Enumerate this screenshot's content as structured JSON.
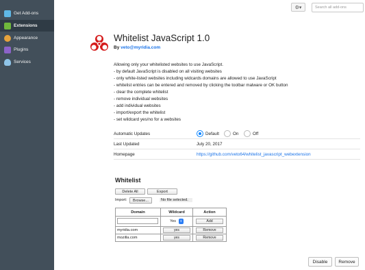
{
  "sidebar": {
    "items": [
      {
        "label": "Get Add-ons",
        "icon": "get-addons-icon",
        "color": "#5fb8e6"
      },
      {
        "label": "Extensions",
        "icon": "puzzle-icon",
        "color": "#6fb83c"
      },
      {
        "label": "Appearance",
        "icon": "palette-icon",
        "color": "#e6a23c"
      },
      {
        "label": "Plugins",
        "icon": "plugin-icon",
        "color": "#8c63c9"
      },
      {
        "label": "Services",
        "icon": "cloud-icon",
        "color": "#8fc4e8"
      }
    ]
  },
  "toolbar": {
    "gear_label": "⚙▾",
    "search_placeholder": "Search all add-ons"
  },
  "addon": {
    "title": "Whitelist JavaScript 1.0",
    "by_prefix": "By",
    "author": "veto@myridia.com",
    "description": [
      "Allowing only your whitelisted websites to use JavaScript.",
      "- by default JavaScript is disabled on all visiting websites",
      "- only white-listed websites including widcards domains are allowed to use JavaScript",
      "- whitelist entries can be entered and removed by clicking the toolbar malware or OK button",
      "- clear the complete whitelist",
      "- remove individual websites",
      "- add individual websites",
      "- import/export the whitelist",
      "- set wildcard yes/no for a websites"
    ]
  },
  "details": {
    "auto_updates_label": "Automatic Updates",
    "auto_updates_options": [
      "Default",
      "On",
      "Off"
    ],
    "auto_updates_selected": "Default",
    "last_updated_label": "Last Updated",
    "last_updated_value": "July 20, 2017",
    "homepage_label": "Homepage",
    "homepage_value": "https://github.com/veto64/whitelist_javascript_webextension"
  },
  "whitelist": {
    "title": "Whitelist",
    "delete_all": "Delete All",
    "export": "Export",
    "import_label": "Import:",
    "browse": "Browse...",
    "no_file": "No file selected.",
    "headers": [
      "Domain",
      "Wildcard",
      "Action"
    ],
    "new_row": {
      "wildcard": "Yes",
      "action": "Add"
    },
    "rows": [
      {
        "domain": "myridia.com",
        "wildcard": "yes",
        "action": "Remove"
      },
      {
        "domain": "mozilla.com",
        "wildcard": "yes",
        "action": "Remove"
      }
    ]
  },
  "footer": {
    "disable": "Disable",
    "remove": "Remove"
  }
}
